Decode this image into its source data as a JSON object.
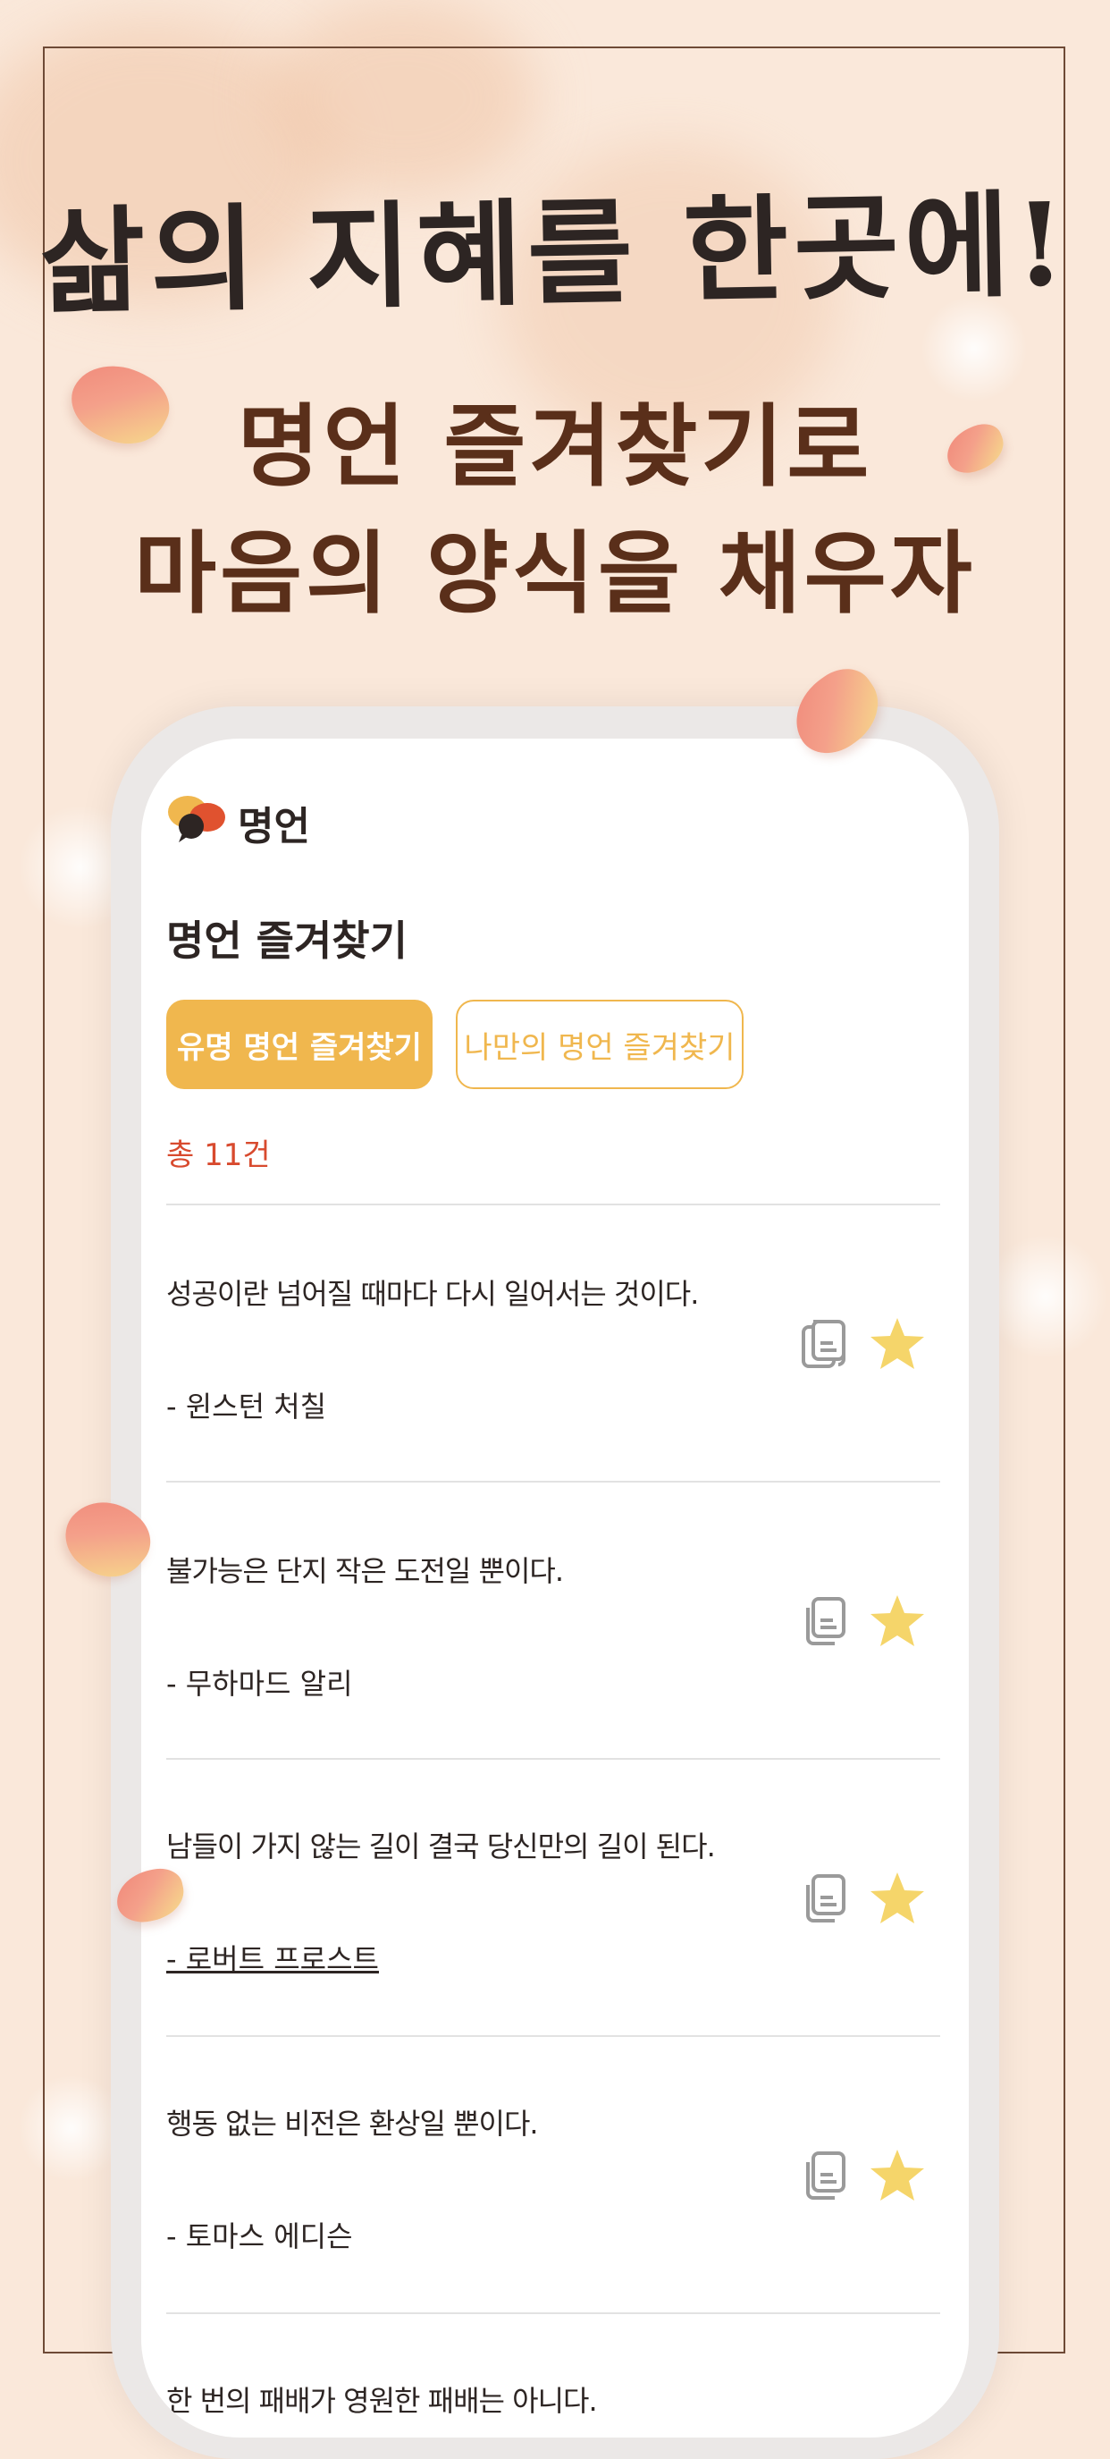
{
  "headline": "삶의 지혜를 한곳에!",
  "subheadline_line1": "명언 즐겨찾기로",
  "subheadline_line2": "마음의 양식을 채우자",
  "app": {
    "name": "명언",
    "page_title": "명언 즐겨찾기",
    "tabs": [
      {
        "label": "유명 명언 즐겨찾기",
        "active": true
      },
      {
        "label": "나만의 명언 즐겨찾기",
        "active": false
      }
    ],
    "count_label": "총 11건",
    "quotes": [
      {
        "text": "성공이란 넘어질 때마다 다시 일어서는 것이다.",
        "author": "- 윈스턴 처칠"
      },
      {
        "text": "불가능은 단지 작은 도전일 뿐이다.",
        "author": "- 무하마드 알리"
      },
      {
        "text": "남들이 가지 않는 길이 결국 당신만의 길이 된다.",
        "author": "- 로버트 프로스트"
      },
      {
        "text": "행동 없는 비전은 환상일 뿐이다.",
        "author": "- 토마스 에디슨"
      },
      {
        "text": "한 번의 패배가 영원한 패배는 아니다.",
        "author": ""
      }
    ],
    "icons": {
      "copy": "copy-icon",
      "favorite": "star-icon"
    }
  },
  "colors": {
    "background": "#fae8da",
    "accent": "#f0b74e",
    "count": "#d84a2e",
    "headline_brown": "#5a2f1a",
    "star": "#f5d56a"
  }
}
